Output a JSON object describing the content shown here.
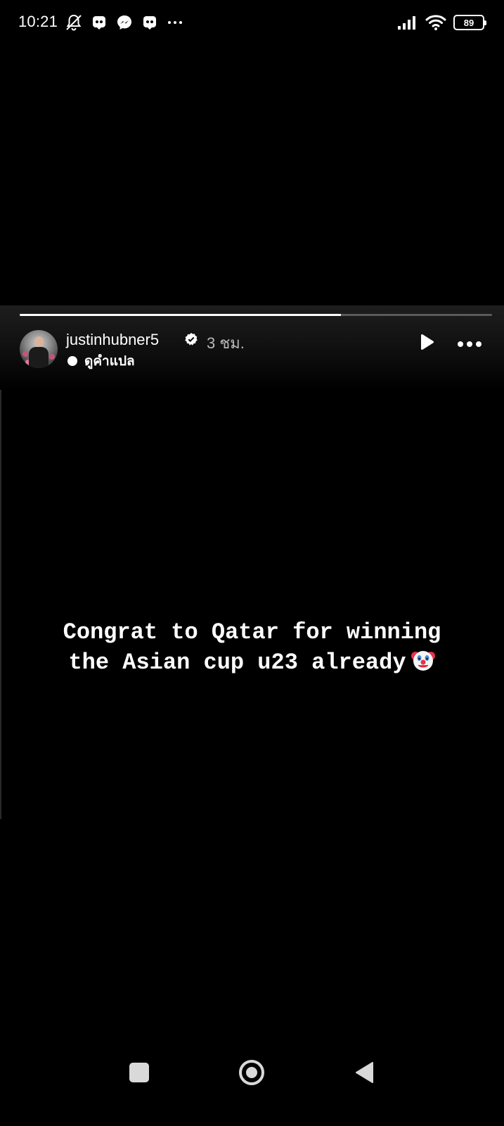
{
  "status_bar": {
    "time": "10:21",
    "battery_level": "89",
    "left_icons": [
      "bell-muted-icon",
      "app-notification-icon",
      "messenger-icon",
      "app-notification-icon",
      "more-dots-icon"
    ],
    "right_icons": [
      "signal-icon",
      "wifi-icon",
      "battery-icon"
    ]
  },
  "story": {
    "progress": 0.68,
    "username": "justinhubner5",
    "verified": true,
    "timestamp": "3 ชม.",
    "translate_label": "ดูคำแปล",
    "text_lines": [
      "Congrat to Qatar for winning",
      "the Asian cup u23 already"
    ],
    "trailing_emoji": "clown-face-icon",
    "actions": [
      "play-icon",
      "more-options-icon"
    ]
  },
  "nav_bar": {
    "buttons": [
      "recents-button",
      "home-button",
      "back-button"
    ]
  },
  "colors": {
    "background": "#000000",
    "text": "#ffffff",
    "secondary_text": "#b9b9b9",
    "progress_track": "#5a5a5a"
  }
}
